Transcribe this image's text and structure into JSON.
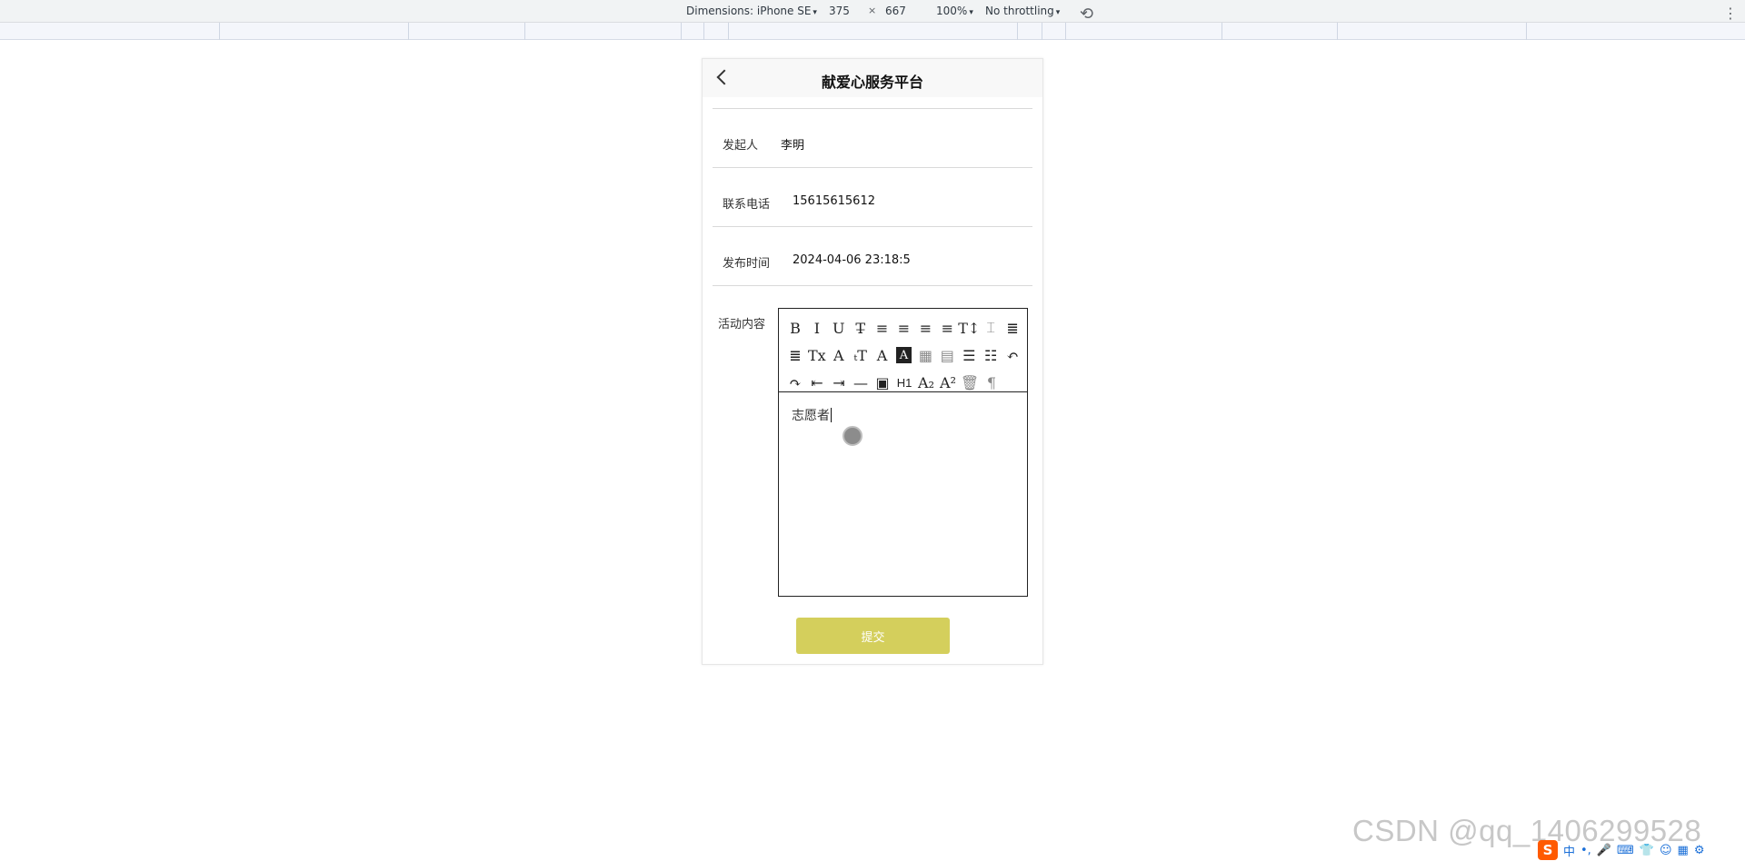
{
  "devtools": {
    "dimensions_label": "Dimensions: iPhone SE",
    "width": "375",
    "times": "×",
    "height": "667",
    "zoom": "100%",
    "throttling": "No throttling",
    "caret": "▾",
    "rotate_glyph": "⟲",
    "menu_glyph": "⋮"
  },
  "nav": {
    "title": "献爱心服务平台"
  },
  "form": {
    "initiator_label": "发起人",
    "initiator_value": "李明",
    "phone_label": "联系电话",
    "phone_value": "15615615612",
    "time_label": "发布时间",
    "time_value": "2024-04-06 23:18:5",
    "content_label": "活动内容",
    "content_value": "志愿者"
  },
  "toolbar": {
    "rows": [
      [
        "B",
        "I",
        "U",
        "T̶",
        "≡",
        "≡",
        "≡",
        "≡",
        "T↕",
        "⌶",
        "≣"
      ],
      [
        "≣",
        "Tx",
        "A",
        "ₜT",
        "A",
        "A",
        "▦",
        "▤",
        "☰",
        "☷",
        "↶"
      ],
      [
        "↷",
        "⇤",
        "⇥",
        "—",
        "▣",
        "H1",
        "A₂",
        "A²",
        "🗑",
        "¶"
      ]
    ]
  },
  "submit_label": "提交",
  "watermark": "CSDN @qq_1406299528",
  "ime": {
    "logo": "S",
    "lang": "中",
    "punct": "•,"
  },
  "colors": {
    "submit_bg": "#d4cf5c",
    "nav_bg": "#f8f8f8",
    "watermark": "#c7c7c7"
  }
}
